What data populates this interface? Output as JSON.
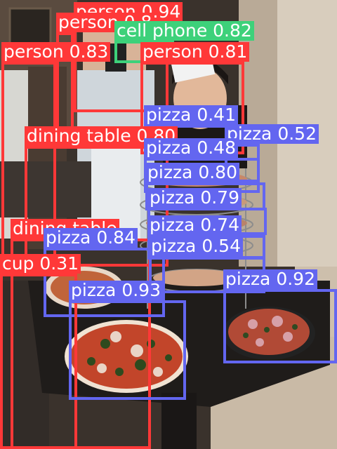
{
  "image": {
    "description_free": true
  },
  "colors": {
    "person": "#ff3838",
    "dining table": "#ff3838",
    "cup": "#ff3838",
    "cell phone": "#3dd17a",
    "pizza": "#6366f0"
  },
  "detections": [
    {
      "label": "person 0.94"
    },
    {
      "label": "person 0.8"
    },
    {
      "label": "cell phone 0.82"
    },
    {
      "label": "person 0.83"
    },
    {
      "label": "person 0.81"
    },
    {
      "label": "pizza 0.41"
    },
    {
      "label": "dining table 0.80"
    },
    {
      "label": "pizza 0.52"
    },
    {
      "label": "pizza 0.48"
    },
    {
      "label": "pizza 0.80"
    },
    {
      "label": "pizza 0.79"
    },
    {
      "label": "dining table"
    },
    {
      "label": "pizza 0.74"
    },
    {
      "label": "pizza 0.84"
    },
    {
      "label": "pizza 0.54"
    },
    {
      "label": "cup 0.31"
    },
    {
      "label": "pizza 0.92"
    },
    {
      "label": "pizza 0.93"
    }
  ]
}
